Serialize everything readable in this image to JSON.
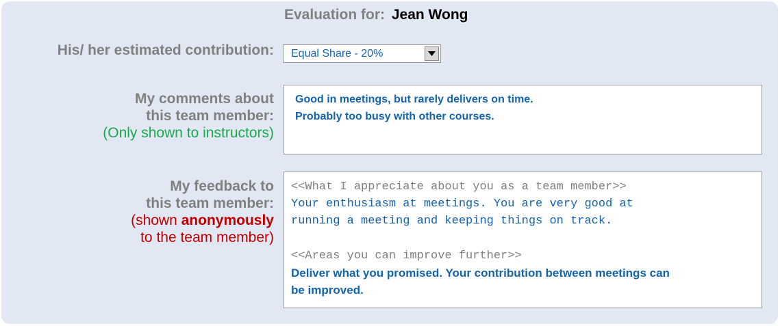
{
  "header": {
    "prefix": "Evaluation for:",
    "name": "Jean Wong"
  },
  "contribution": {
    "label": "His/ her estimated contribution:",
    "selected": "Equal Share - 20%",
    "dropdown_icon": "chevron-down-icon"
  },
  "comments": {
    "label_line1": "My comments about",
    "label_line2": "this team member:",
    "note": "(Only shown to instructors)",
    "lines": [
      "Good in meetings, but rarely delivers on time.",
      "Probably too busy with other courses."
    ]
  },
  "feedback": {
    "label_line1": "My feedback to",
    "label_line2": "this team member:",
    "note_prefix": "(shown",
    "note_bold": "anonymously",
    "note_line2": "to the team member)",
    "prompt1": "<<What I appreciate about you as a team member>>",
    "answer1_lines": [
      "Your enthusiasm at meetings. You are very good at",
      "running a meeting and keeping things on track."
    ],
    "prompt2": "<<Areas you can improve further>>",
    "answer2_lines": [
      "Deliver what you promised. Your contribution between meetings can",
      "be improved."
    ]
  },
  "colors": {
    "panel_bg": "#e2e8f3",
    "label_gray": "#808080",
    "text_blue": "#1464ad",
    "note_green": "#1aa84c",
    "note_red": "#c00000"
  }
}
